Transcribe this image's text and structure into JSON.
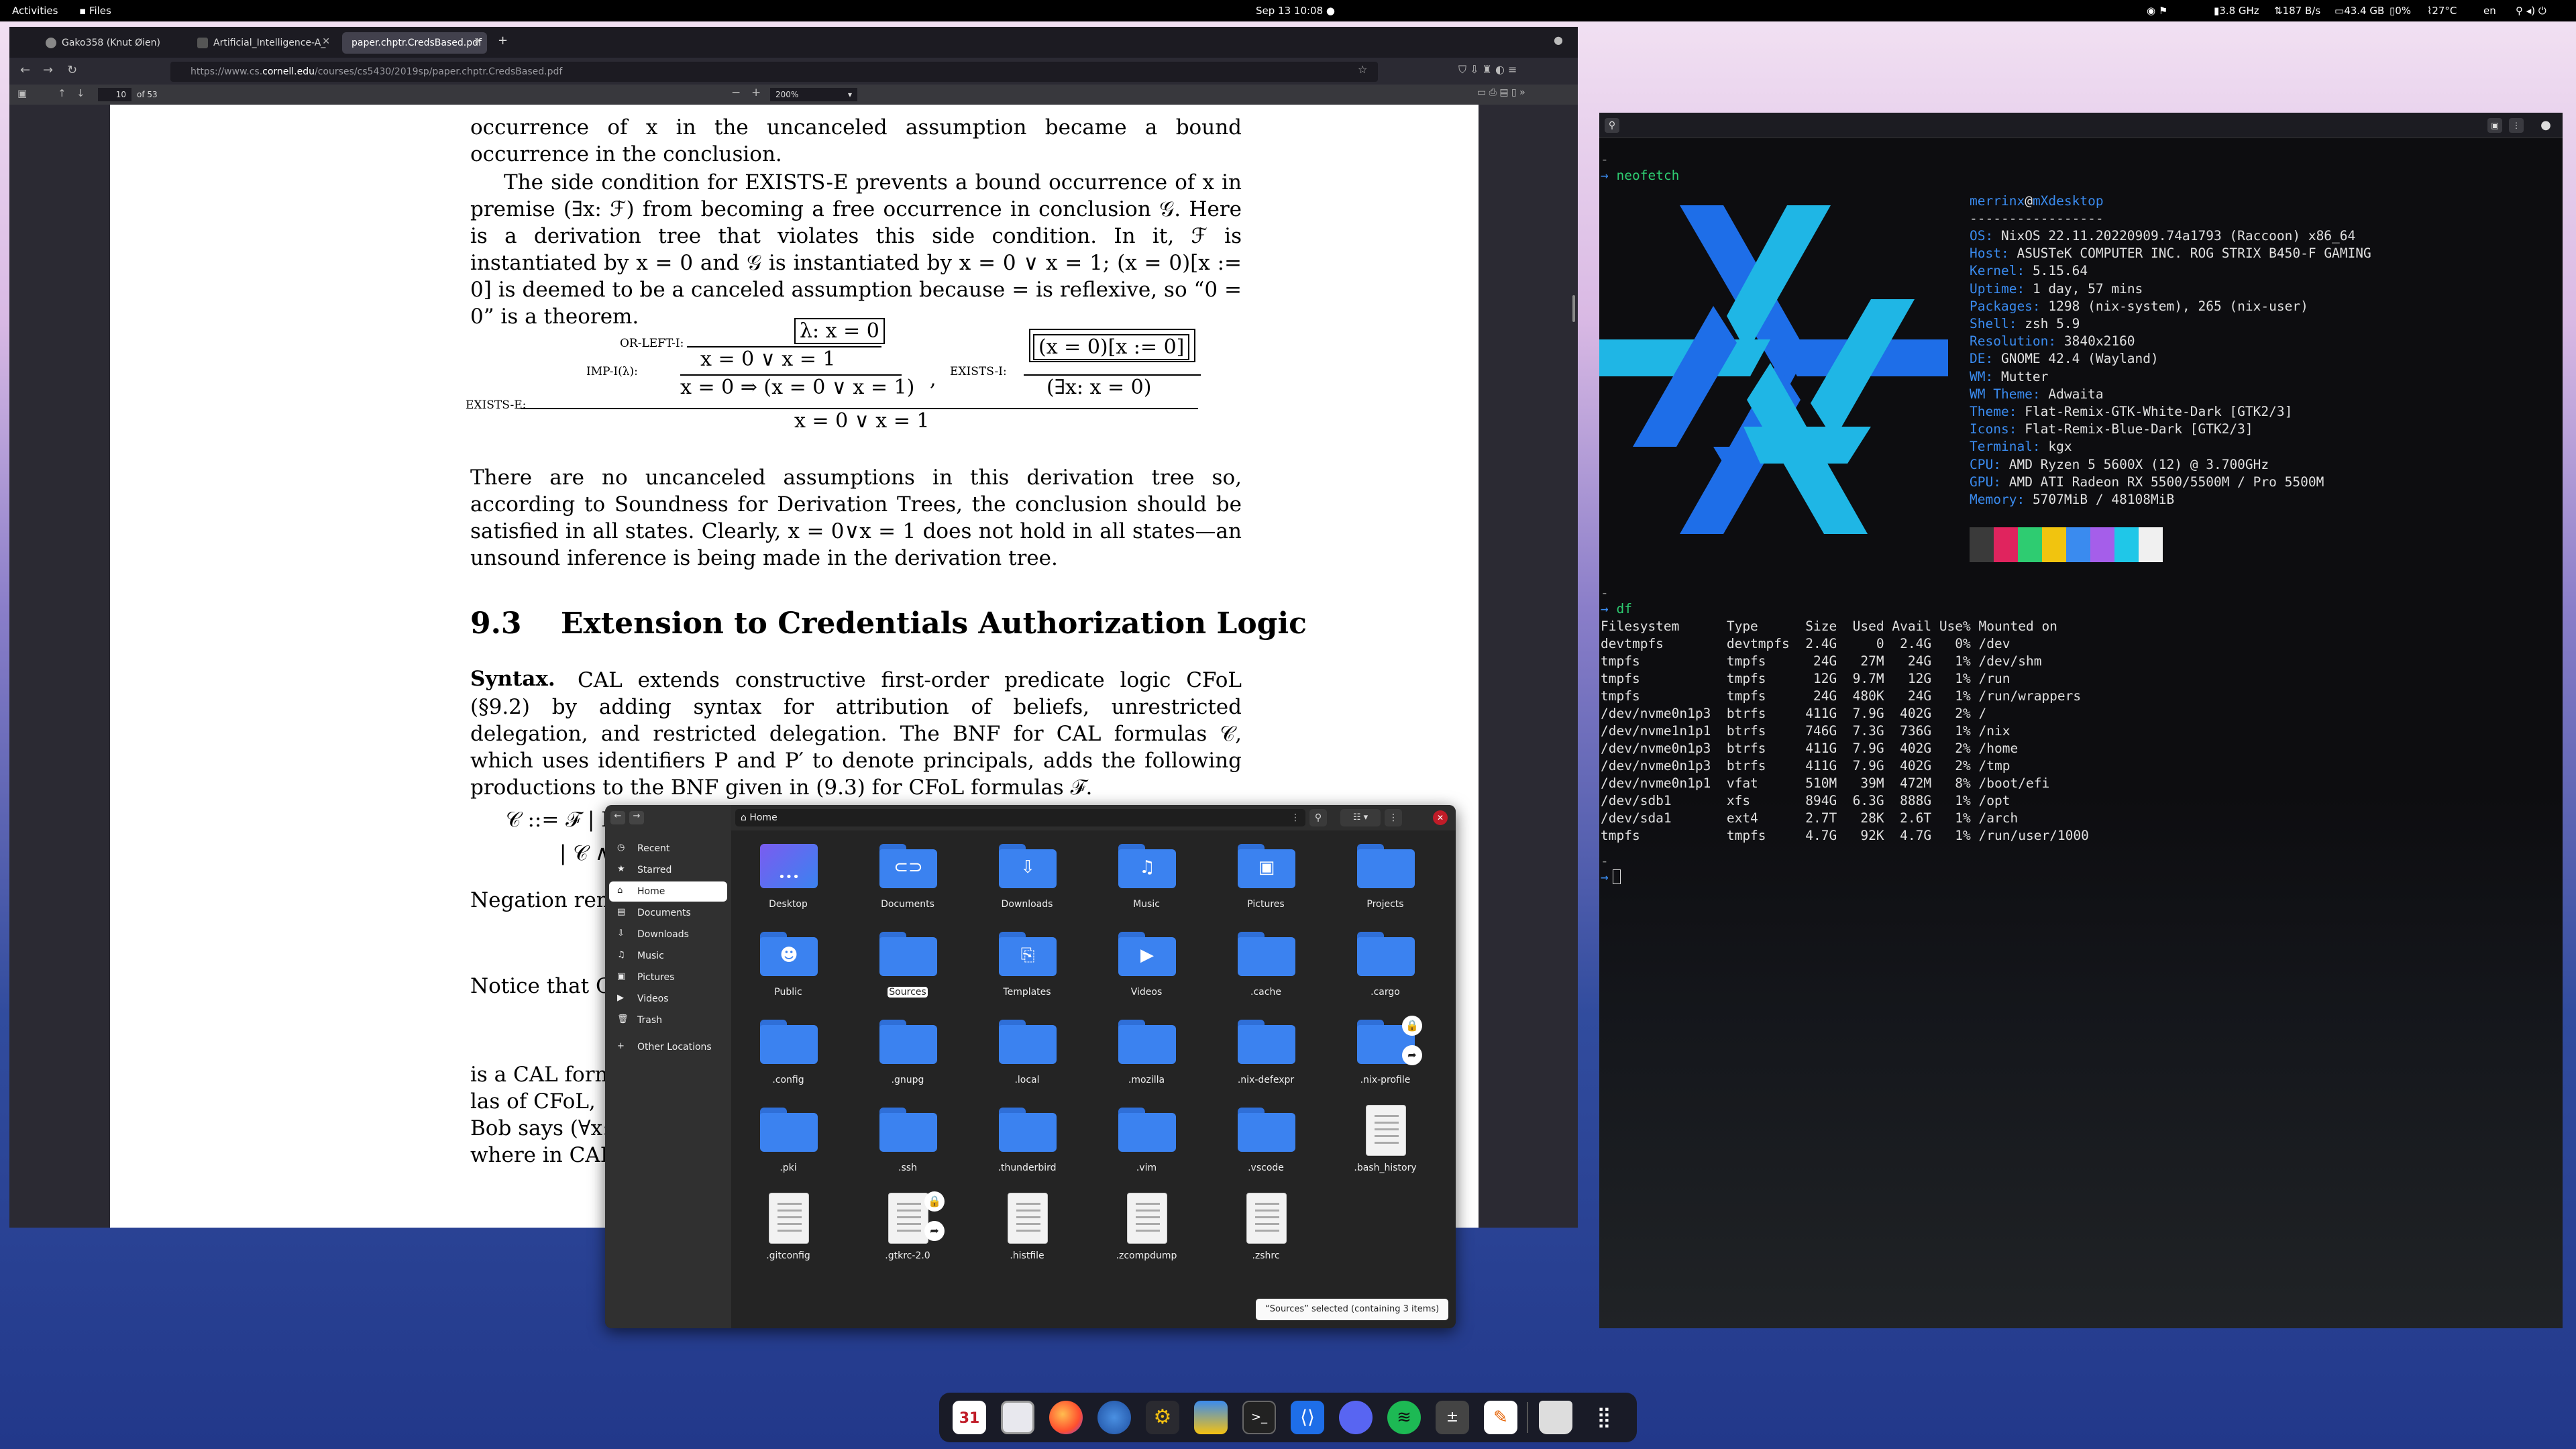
{
  "topbar": {
    "activities": "Activities",
    "app": "Files",
    "clock": "Sep 13  10:08",
    "cpu": "3.8 GHz",
    "net": "187 B/s",
    "mem": "43.4 GB",
    "bat": "0%",
    "temp": "27°C",
    "lang": "en"
  },
  "browser": {
    "tabs": [
      "Gako358 (Knut Øien)",
      "Artificial_Intelligence-A_",
      "paper.chptr.CredsBased.pdf"
    ],
    "url_prefix": "https://www.cs.",
    "url_domain": "cornell.edu",
    "url_suffix": "/courses/cs5430/2019sp/paper.chptr.CredsBased.pdf",
    "page_current": "10",
    "page_of": "of 53",
    "zoom": "200%"
  },
  "pdf": {
    "para1_top": "occurrence of x in the uncanceled assumption became a bound occurrence in the conclusion.",
    "para2": "The side condition for EXISTS-E prevents a bound occurrence of x in premise (∃x: ℱ) from becoming a free occurrence in conclusion 𝒢. Here is a derivation tree that violates this side condition. In it, ℱ is instantiated by x = 0 and 𝒢 is instantiated by x = 0 ∨ x = 1; (x = 0)[x := 0] is deemed to be a canceled assumption because = is reflexive, so “0 = 0” is a theorem.",
    "tree": {
      "lambda": "λ: x = 0",
      "orleft": "OR-LEFT-I:",
      "orres": "x = 0 ∨ x = 1",
      "imp": "IMP-I(λ):",
      "impres": "x = 0 ⇒ (x = 0 ∨ x = 1)",
      "comma": ",",
      "exi": "EXISTS-I:",
      "exitop": "(x = 0)[x := 0]",
      "exires": "(∃x:   x = 0)",
      "exe": "EXISTS-E:",
      "final": "x = 0 ∨ x = 1"
    },
    "para3": "There are no uncanceled assumptions in this derivation tree so, according to Soundness for Derivation Trees, the conclusion should be satisfied in all states. Clearly, x = 0∨x = 1 does not hold in all states—an unsound inference is being made in the derivation tree.",
    "sec_num": "9.3",
    "sec_title": "Extension to Credentials Authorization Logic",
    "syntax_lbl": "Syntax.",
    "para4": "CAL extends constructive first-order predicate logic CFoL (§9.2) by adding syntax for attribution of beliefs, unrestricted delegation, and restricted delegation. The BNF for CAL formulas 𝒞, which uses identifiers P and P′ to denote principals, adds the following productions to the BNF given in (9.3) for CFoL formulas ℱ.",
    "bnf1": "𝒞 ::= ℱ  |  P says 𝒞  |",
    "bnf2": "|  𝒞 ∧",
    "neg": "Negation rema",
    "notice": "Notice that C",
    "isacal": "is a CAL form",
    "lasof": "las of CFoL,",
    "bob": "Bob says (∀x:",
    "where": "where in CAL"
  },
  "terminal": {
    "prompt": "→",
    "cmd1": "neofetch",
    "user": "merrinx",
    "at": "@",
    "host": "mXdesktop",
    "sep": "-----------------",
    "info": [
      {
        "k": "OS",
        "v": "NixOS 22.11.20220909.74a1793 (Raccoon) x86_64"
      },
      {
        "k": "Host",
        "v": "ASUSTeK COMPUTER INC. ROG STRIX B450-F GAMING"
      },
      {
        "k": "Kernel",
        "v": "5.15.64"
      },
      {
        "k": "Uptime",
        "v": "1 day, 57 mins"
      },
      {
        "k": "Packages",
        "v": "1298 (nix-system), 265 (nix-user)"
      },
      {
        "k": "Shell",
        "v": "zsh 5.9"
      },
      {
        "k": "Resolution",
        "v": "3840x2160"
      },
      {
        "k": "DE",
        "v": "GNOME 42.4 (Wayland)"
      },
      {
        "k": "WM",
        "v": "Mutter"
      },
      {
        "k": "WM Theme",
        "v": "Adwaita"
      },
      {
        "k": "Theme",
        "v": "Flat-Remix-GTK-White-Dark [GTK2/3]"
      },
      {
        "k": "Icons",
        "v": "Flat-Remix-Blue-Dark [GTK2/3]"
      },
      {
        "k": "Terminal",
        "v": "kgx"
      },
      {
        "k": "CPU",
        "v": "AMD Ryzen 5 5600X (12) @ 3.700GHz"
      },
      {
        "k": "GPU",
        "v": "AMD ATI Radeon RX 5500/5500M / Pro 5500M"
      },
      {
        "k": "Memory",
        "v": "5707MiB / 48108MiB"
      }
    ],
    "swatches": [
      "#3a3a3a",
      "#e0245e",
      "#2ecc71",
      "#f1c40f",
      "#3a8bef",
      "#a55eea",
      "#1fc7e8",
      "#f0f0f0"
    ],
    "cmd2": "df",
    "df_header": "Filesystem      Type      Size  Used Avail Use% Mounted on",
    "df_rows": [
      "devtmpfs        devtmpfs  2.4G     0  2.4G   0% /dev",
      "tmpfs           tmpfs      24G   27M   24G   1% /dev/shm",
      "tmpfs           tmpfs      12G  9.7M   12G   1% /run",
      "tmpfs           tmpfs      24G  480K   24G   1% /run/wrappers",
      "/dev/nvme0n1p3  btrfs     411G  7.9G  402G   2% /",
      "/dev/nvme1n1p1  btrfs     746G  7.3G  736G   1% /nix",
      "/dev/nvme0n1p3  btrfs     411G  7.9G  402G   2% /home",
      "/dev/nvme0n1p3  btrfs     411G  7.9G  402G   2% /tmp",
      "/dev/nvme0n1p1  vfat      510M   39M  472M   8% /boot/efi",
      "/dev/sdb1       xfs       894G  6.3G  888G   1% /opt",
      "/dev/sda1       ext4      2.7T   28K  2.6T   1% /arch",
      "tmpfs           tmpfs     4.7G   92K  4.7G   1% /run/user/1000"
    ],
    "cursor_prompt": "→"
  },
  "files": {
    "location": "Home",
    "sidebar": [
      "Recent",
      "Starred",
      "Home",
      "Documents",
      "Downloads",
      "Music",
      "Pictures",
      "Videos",
      "Trash",
      "Other Locations"
    ],
    "items": [
      {
        "name": "Desktop",
        "kind": "desktop"
      },
      {
        "name": "Documents",
        "kind": "folder",
        "glyph": "⊂⊃"
      },
      {
        "name": "Downloads",
        "kind": "folder",
        "glyph": "⇩"
      },
      {
        "name": "Music",
        "kind": "folder",
        "glyph": "♫"
      },
      {
        "name": "Pictures",
        "kind": "folder",
        "glyph": "▣"
      },
      {
        "name": "Projects",
        "kind": "folder",
        "glyph": ""
      },
      {
        "name": "Public",
        "kind": "folder",
        "glyph": "☻"
      },
      {
        "name": "Sources",
        "kind": "folder",
        "glyph": "",
        "selected": true
      },
      {
        "name": "Templates",
        "kind": "folder",
        "glyph": "⎘"
      },
      {
        "name": "Videos",
        "kind": "folder",
        "glyph": "▶"
      },
      {
        "name": ".cache",
        "kind": "folder",
        "glyph": ""
      },
      {
        "name": ".cargo",
        "kind": "folder",
        "glyph": ""
      },
      {
        "name": ".config",
        "kind": "folder",
        "glyph": ""
      },
      {
        "name": ".gnupg",
        "kind": "folder",
        "glyph": ""
      },
      {
        "name": ".local",
        "kind": "folder",
        "glyph": ""
      },
      {
        "name": ".mozilla",
        "kind": "folder",
        "glyph": ""
      },
      {
        "name": ".nix-defexpr",
        "kind": "folder",
        "glyph": ""
      },
      {
        "name": ".nix-profile",
        "kind": "folder",
        "glyph": "",
        "lock": true
      },
      {
        "name": ".pki",
        "kind": "folder",
        "glyph": ""
      },
      {
        "name": ".ssh",
        "kind": "folder",
        "glyph": ""
      },
      {
        "name": ".thunderbird",
        "kind": "folder",
        "glyph": ""
      },
      {
        "name": ".vim",
        "kind": "folder",
        "glyph": ""
      },
      {
        "name": ".vscode",
        "kind": "folder",
        "glyph": ""
      },
      {
        "name": ".bash_history",
        "kind": "doc"
      },
      {
        "name": ".gitconfig",
        "kind": "doc"
      },
      {
        "name": ".gtkrc-2.0",
        "kind": "doc",
        "lock": true
      },
      {
        "name": ".histfile",
        "kind": "doc"
      },
      {
        "name": ".zcompdump",
        "kind": "doc"
      },
      {
        "name": ".zshrc",
        "kind": "doc"
      }
    ],
    "status": "“Sources” selected  (containing 3 items)"
  },
  "dock": {
    "calendar_day": "31"
  }
}
